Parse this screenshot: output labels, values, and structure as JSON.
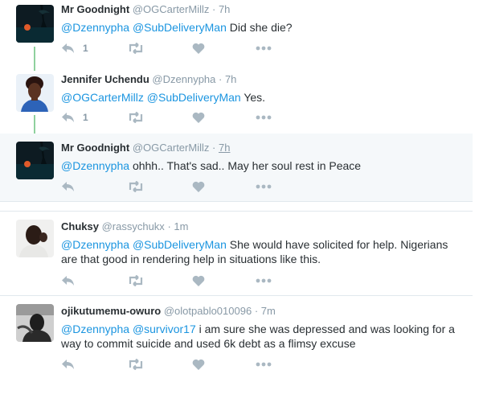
{
  "tweets": [
    {
      "fullname": "Mr Goodnight",
      "handle": "@OGCarterMillz",
      "time": "· 7h",
      "mentions": [
        "@Dzennypha",
        "@SubDeliveryMan"
      ],
      "text": "Did she die?",
      "reply_count": "1",
      "avatar": "moon-night-avatar"
    },
    {
      "fullname": "Jennifer Uchendu",
      "handle": "@Dzennypha",
      "time": "· 7h",
      "mentions": [
        "@OGCarterMillz",
        "@SubDeliveryMan"
      ],
      "text": "Yes.",
      "reply_count": "1",
      "avatar": "woman-portrait-avatar"
    },
    {
      "fullname": "Mr Goodnight",
      "handle": "@OGCarterMillz",
      "time_sep": "·",
      "time": "7h",
      "mentions": [
        "@Dzennypha"
      ],
      "text": "ohhh.. That's sad.. May her soul rest in Peace",
      "reply_count": "",
      "avatar": "moon-night-avatar"
    },
    {
      "fullname": "Chuksy",
      "handle": "@rassychukx",
      "time": "· 1m",
      "mentions": [
        "@Dzennypha",
        "@SubDeliveryMan"
      ],
      "text_line1": "She would have solicited for help. Nigerians",
      "text_line2": "are that good in rendering help in situations like this.",
      "reply_count": "",
      "avatar": "man-portrait-avatar"
    },
    {
      "fullname": "ojikutumemu-owuro",
      "handle": "@olotpablo010096",
      "time": "· 7m",
      "mentions": [
        "@Dzennypha",
        "@survivor17"
      ],
      "text_line1": "i am sure she was  depressed and was looking for a",
      "text_line2": "way to commit suicide  and used 6k debt as a flimsy excuse",
      "reply_count": "",
      "avatar": "man-in-car-avatar"
    }
  ],
  "icons": {
    "reply": "reply-icon",
    "retweet": "retweet-icon",
    "like": "heart-icon",
    "more": "more-dots-icon"
  },
  "colors": {
    "mention": "#1b95e0",
    "muted": "#8899a6",
    "icon": "#aab8c2",
    "thread_line": "#8fd19e",
    "highlight_bg": "#f5f8fa"
  }
}
